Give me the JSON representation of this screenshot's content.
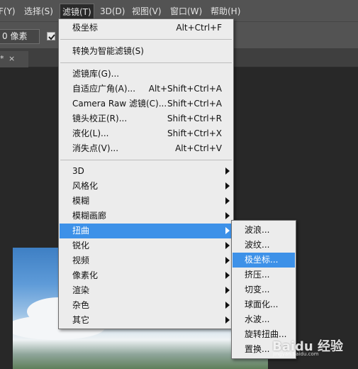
{
  "menubar": {
    "items": [
      {
        "label": "F(Y)"
      },
      {
        "label": "选择(S)"
      },
      {
        "label": "滤镜(T)"
      },
      {
        "label": "3D(D)"
      },
      {
        "label": "视图(V)"
      },
      {
        "label": "窗口(W)"
      },
      {
        "label": "帮助(H)"
      }
    ],
    "active": "滤镜(T)"
  },
  "options_bar": {
    "feather_value": "0 像素",
    "checkbox_checked": true
  },
  "tabbar": {
    "tab_suffix": "*",
    "close_glyph": "×"
  },
  "filter_menu": {
    "items": [
      {
        "label": "极坐标",
        "shortcut": "Alt+Ctrl+F"
      },
      {
        "label": "转换为智能滤镜(S)",
        "shortcut": ""
      },
      {
        "label": "滤镜库(G)...",
        "shortcut": ""
      },
      {
        "label": "自适应广角(A)...",
        "shortcut": "Alt+Shift+Ctrl+A"
      },
      {
        "label": "Camera Raw 滤镜(C)...",
        "shortcut": "Shift+Ctrl+A"
      },
      {
        "label": "镜头校正(R)...",
        "shortcut": "Shift+Ctrl+R"
      },
      {
        "label": "液化(L)...",
        "shortcut": "Shift+Ctrl+X"
      },
      {
        "label": "消失点(V)...",
        "shortcut": "Alt+Ctrl+V"
      },
      {
        "label": "3D",
        "submenu": true
      },
      {
        "label": "风格化",
        "submenu": true
      },
      {
        "label": "模糊",
        "submenu": true
      },
      {
        "label": "模糊画廊",
        "submenu": true
      },
      {
        "label": "扭曲",
        "submenu": true,
        "highlighted": true
      },
      {
        "label": "锐化",
        "submenu": true
      },
      {
        "label": "视频",
        "submenu": true
      },
      {
        "label": "像素化",
        "submenu": true
      },
      {
        "label": "渲染",
        "submenu": true
      },
      {
        "label": "杂色",
        "submenu": true
      },
      {
        "label": "其它",
        "submenu": true
      }
    ]
  },
  "distort_submenu": {
    "items": [
      {
        "label": "波浪..."
      },
      {
        "label": "波纹..."
      },
      {
        "label": "极坐标...",
        "highlighted": true
      },
      {
        "label": "挤压..."
      },
      {
        "label": "切变..."
      },
      {
        "label": "球面化..."
      },
      {
        "label": "水波..."
      },
      {
        "label": "旋转扭曲..."
      },
      {
        "label": "置换..."
      }
    ]
  },
  "watermark": {
    "text": "Baidu 经验",
    "sub": "jingyan.baidu.com"
  },
  "colors": {
    "menu_highlight": "#3d91e8",
    "menu_background": "#ececec",
    "chrome": "#535353",
    "workspace": "#282828"
  }
}
